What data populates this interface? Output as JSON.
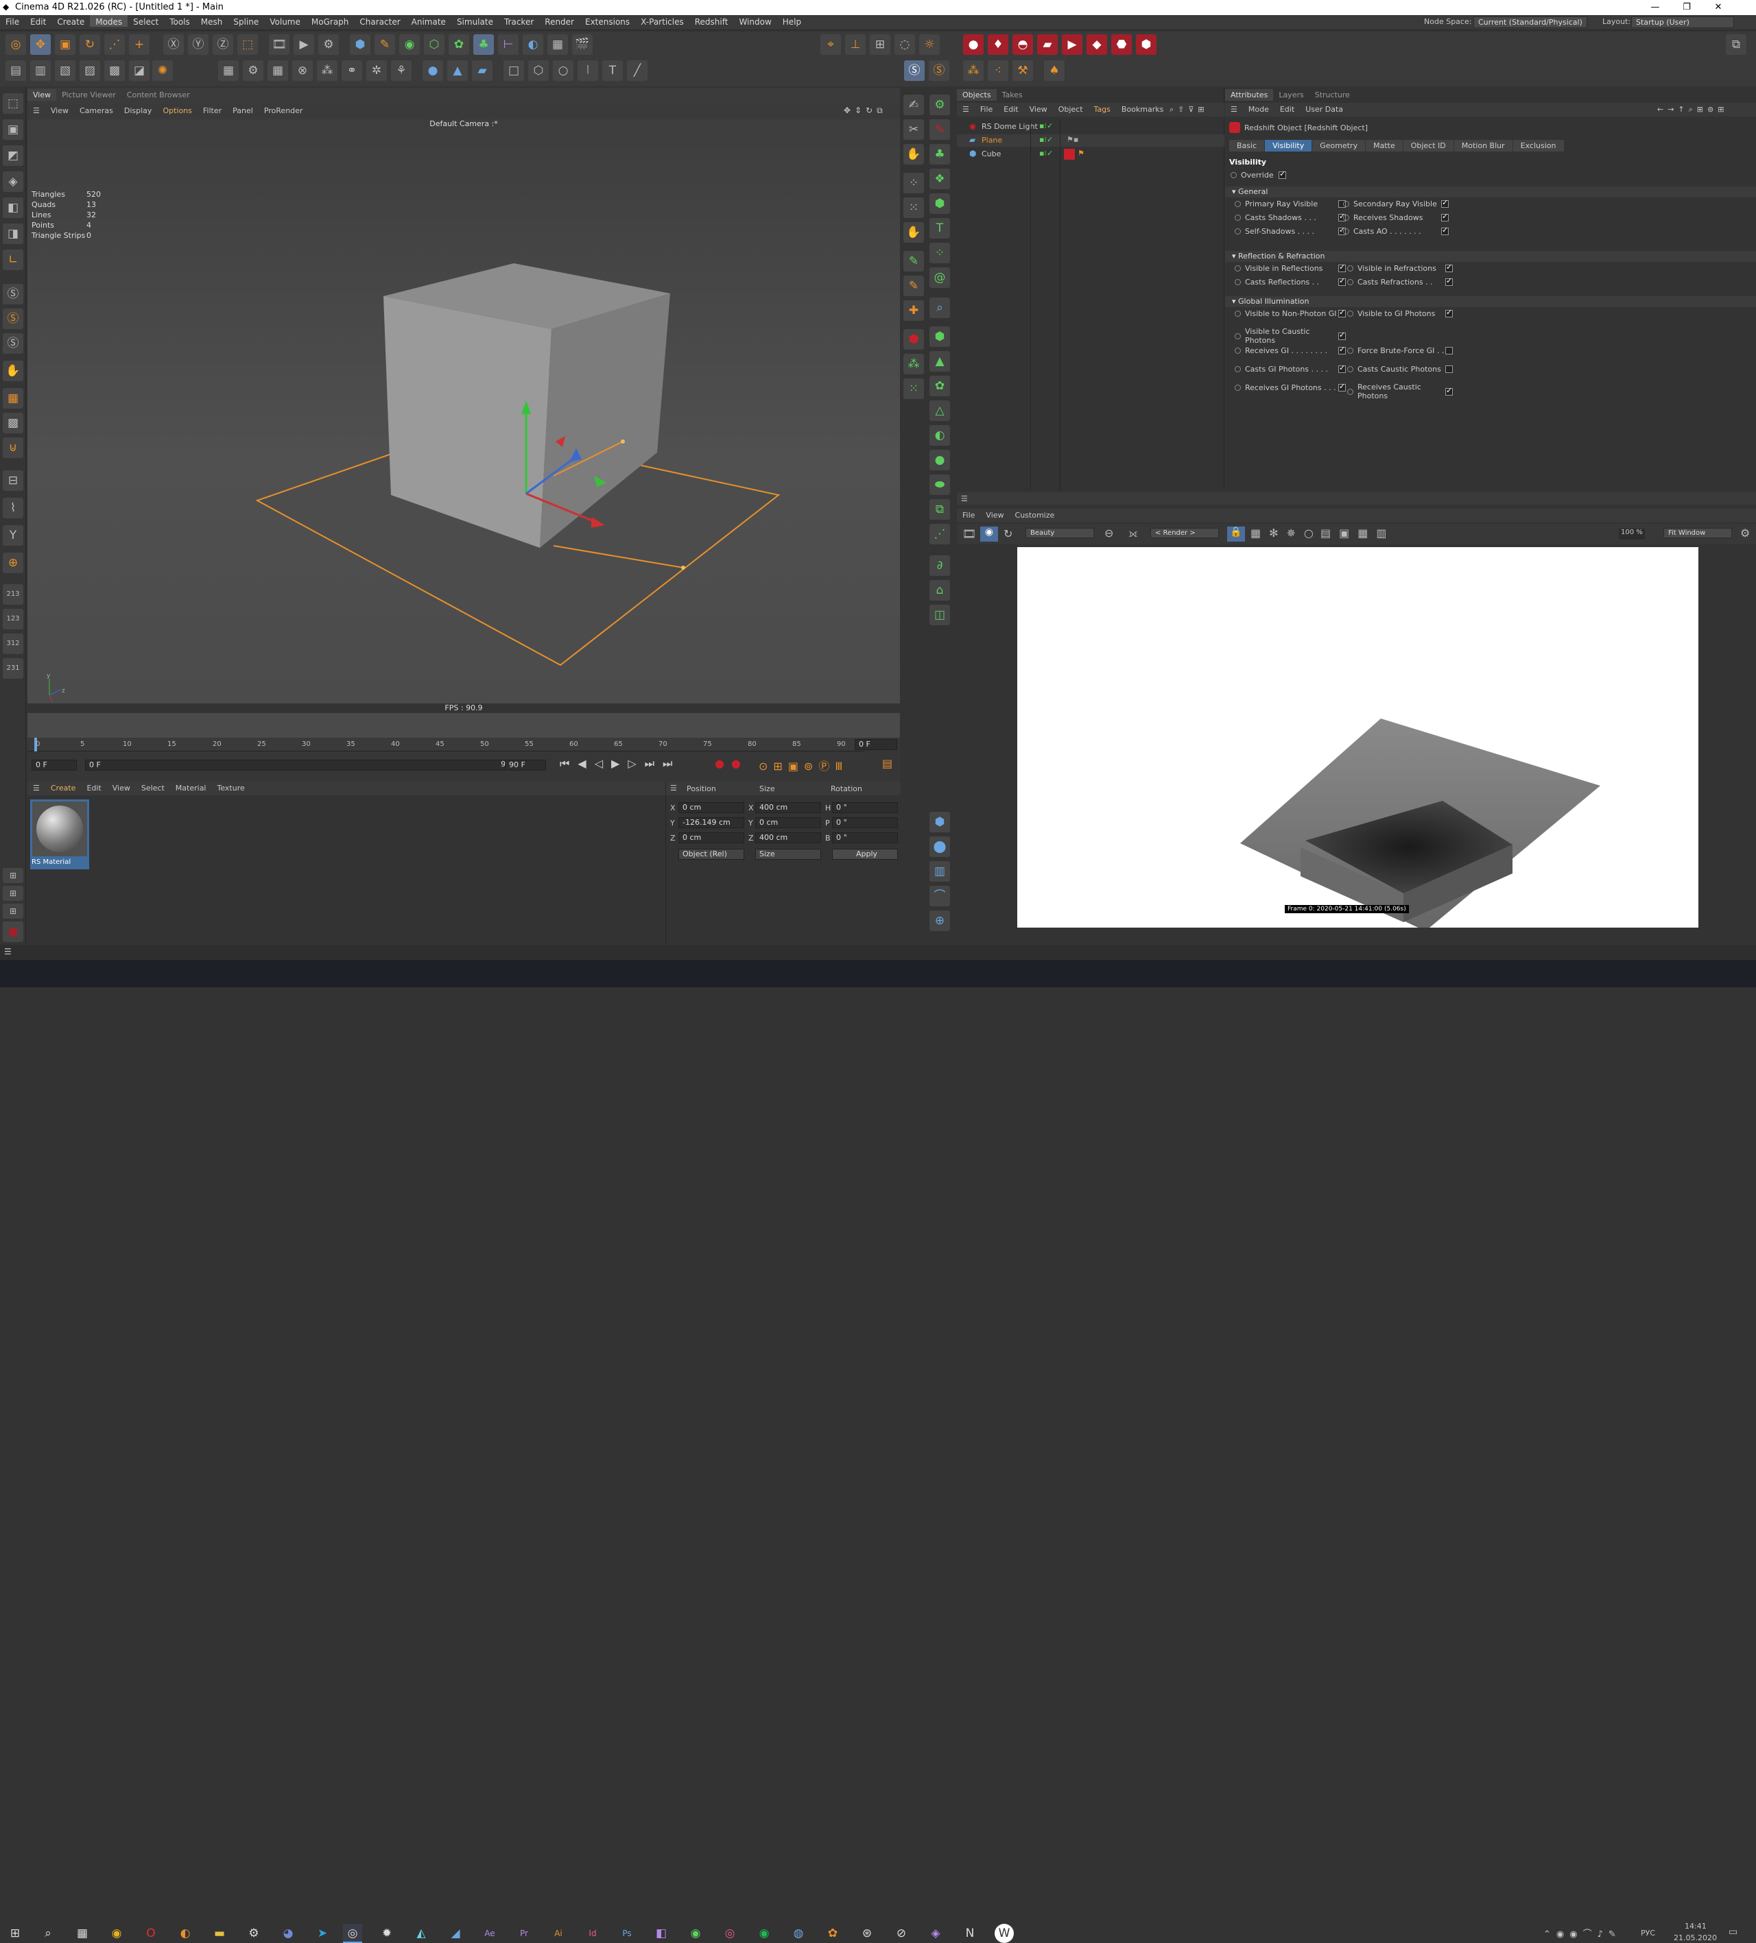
{
  "titlebar": {
    "title": "Cinema 4D R21.026 (RC) - [Untitled 1 *] - Main",
    "min": "—",
    "max": "❐",
    "close": "✕"
  },
  "menus": [
    "File",
    "Edit",
    "Create",
    "Modes",
    "Select",
    "Tools",
    "Mesh",
    "Spline",
    "Volume",
    "MoGraph",
    "Character",
    "Animate",
    "Simulate",
    "Tracker",
    "Render",
    "Extensions",
    "X-Particles",
    "Redshift",
    "Window",
    "Help"
  ],
  "node_space": {
    "label": "Node Space:",
    "value": "Current (Standard/Physical)"
  },
  "layout": {
    "label": "Layout:",
    "value": "Startup (User)"
  },
  "viewport": {
    "tabs": [
      "View",
      "Picture Viewer",
      "Content Browser"
    ],
    "menu": [
      "View",
      "Cameras",
      "Display",
      "Options",
      "Filter",
      "Panel",
      "ProRender"
    ],
    "camera": "Default Camera :*",
    "fps": "FPS : 90.9",
    "stats": [
      {
        "k": "Triangles",
        "v": "520"
      },
      {
        "k": "Quads",
        "v": "13"
      },
      {
        "k": "Lines",
        "v": "32"
      },
      {
        "k": "Points",
        "v": "4"
      },
      {
        "k": "Triangle Strips",
        "v": "0"
      }
    ]
  },
  "timeline": {
    "ticks": [
      "0",
      "5",
      "10",
      "15",
      "20",
      "25",
      "30",
      "35",
      "40",
      "45",
      "50",
      "55",
      "60",
      "65",
      "70",
      "75",
      "80",
      "85",
      "90"
    ],
    "current_frame": "0 F",
    "start": "0 F",
    "start2": "0 F",
    "end": "90 F",
    "end2": "90 F"
  },
  "material_manager": {
    "menu": [
      "Create",
      "Edit",
      "View",
      "Select",
      "Material",
      "Texture"
    ],
    "material_name": "RS Material"
  },
  "coordinates": {
    "headers": [
      "Position",
      "Size",
      "Rotation"
    ],
    "rows": [
      {
        "axis": "X",
        "pos": "0 cm",
        "saxis": "X",
        "size": "400 cm",
        "raxis": "H",
        "rot": "0 °"
      },
      {
        "axis": "Y",
        "pos": "-126.149 cm",
        "saxis": "Y",
        "size": "0 cm",
        "raxis": "P",
        "rot": "0 °"
      },
      {
        "axis": "Z",
        "pos": "0 cm",
        "saxis": "Z",
        "size": "400 cm",
        "raxis": "B",
        "rot": "0 °"
      }
    ],
    "mode": "Object (Rel)",
    "size_mode": "Size",
    "apply": "Apply"
  },
  "objects": {
    "tabs": [
      "Objects",
      "Takes"
    ],
    "menu": [
      "File",
      "Edit",
      "View",
      "Object",
      "Tags",
      "Bookmarks"
    ],
    "items": [
      {
        "name": "RS Dome Light"
      },
      {
        "name": "Plane"
      },
      {
        "name": "Cube"
      }
    ]
  },
  "attributes": {
    "tabs": [
      "Attributes",
      "Layers",
      "Structure"
    ],
    "menu": [
      "Mode",
      "Edit",
      "User Data"
    ],
    "object": "Redshift Object [Redshift Object]",
    "ptabs": [
      "Basic",
      "Visibility",
      "Geometry",
      "Matte",
      "Object ID",
      "Motion Blur",
      "Exclusion"
    ],
    "section": "Visibility",
    "override": "Override",
    "groups": {
      "general": "General",
      "reflection": "Reflection & Refraction",
      "gi": "Global Illumination"
    },
    "general": [
      {
        "l": "Primary Ray Visible",
        "on": false,
        "r": "Secondary Ray Visible",
        "ron": true
      },
      {
        "l": "Casts Shadows . . .",
        "on": true,
        "r": "Receives Shadows",
        "ron": true
      },
      {
        "l": "Self-Shadows . . . .",
        "on": true,
        "r": "Casts AO . . . . . . .",
        "ron": true
      }
    ],
    "reflection": [
      {
        "l": "Visible in Reflections",
        "on": true,
        "r": "Visible in Refractions",
        "ron": true
      },
      {
        "l": "Casts Reflections . .",
        "on": true,
        "r": "Casts Refractions . .",
        "ron": true
      }
    ],
    "gi": [
      {
        "l": "Visible to Non-Photon GI",
        "on": true,
        "r": "Visible to GI Photons",
        "ron": true
      },
      {
        "l": "Visible to Caustic Photons",
        "on": true,
        "r": "",
        "ron": null
      },
      {
        "l": "Receives GI . . . . . . . .",
        "on": true,
        "r": "Force Brute-Force GI . .",
        "ron": false
      },
      {
        "l": "Casts GI Photons . . . .",
        "on": true,
        "r": "Casts Caustic Photons",
        "ron": false
      },
      {
        "l": "Receives GI Photons . . .",
        "on": true,
        "r": "Receives Caustic Photons",
        "ron": true
      }
    ]
  },
  "render_view": {
    "menu": [
      "File",
      "View",
      "Customize"
    ],
    "aov": "Beauty",
    "camera": "< Render >",
    "zoom": "100 %",
    "fit": "Fit Window",
    "frame_info": "Frame  0:  2020-05-21  14:41:00  (5.06s)"
  },
  "taskbar": {
    "lang": "РУС",
    "time": "14:41",
    "date": "21.05.2020"
  },
  "colors": {
    "accent": "#3f6d9e",
    "selection_orange": "#e8912c",
    "redshift_red": "#c8202a"
  }
}
